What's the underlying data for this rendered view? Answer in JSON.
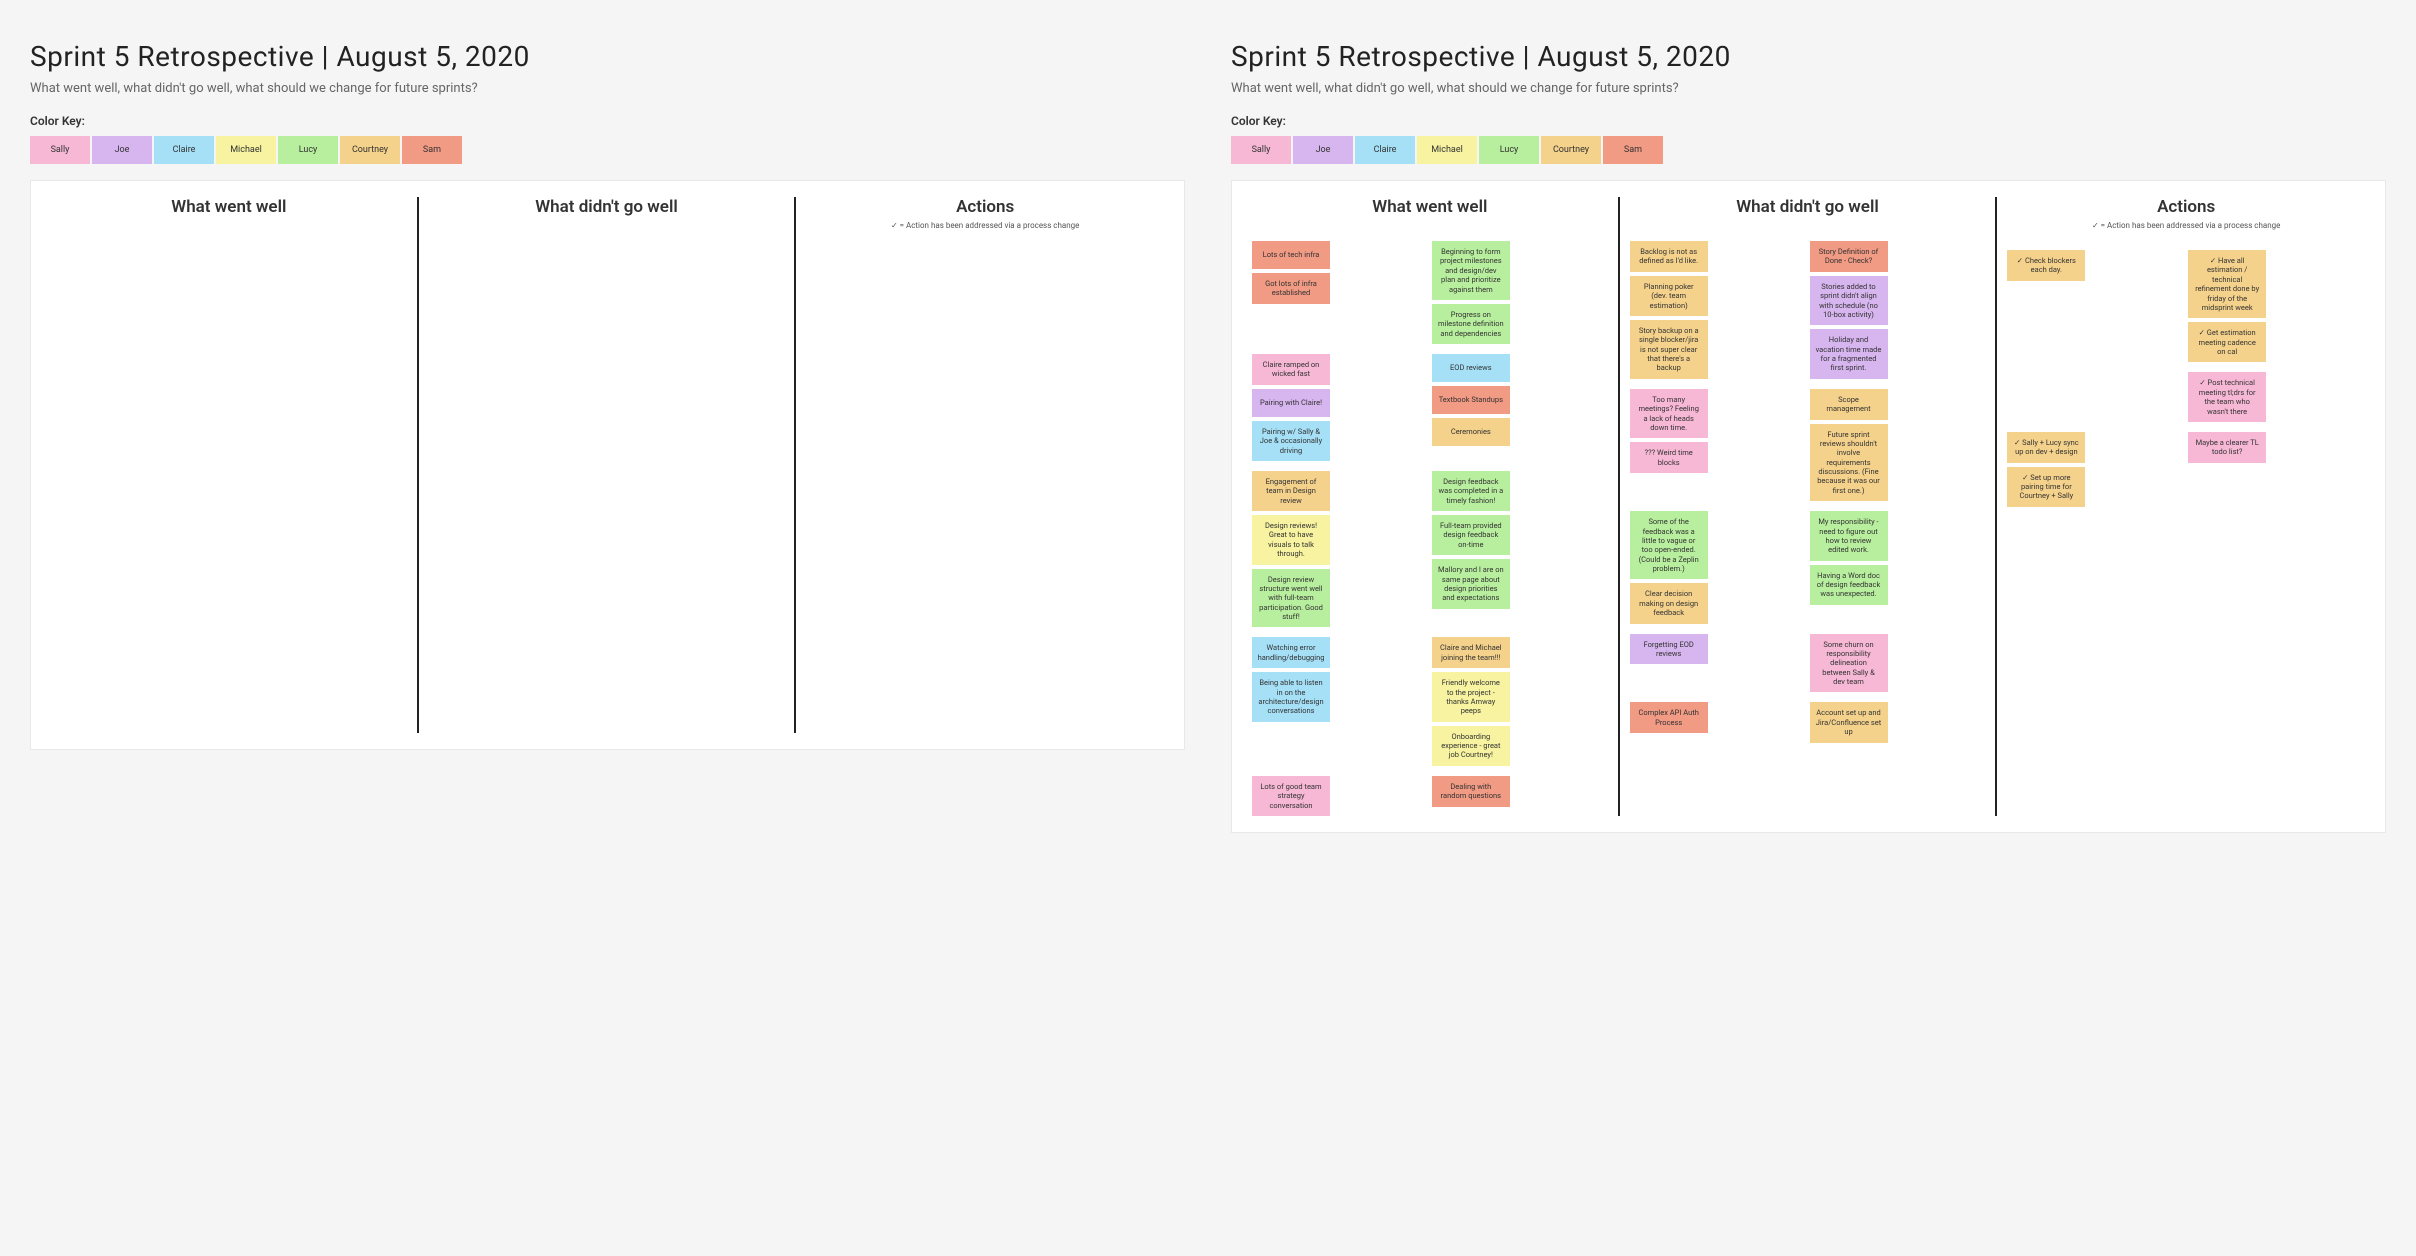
{
  "header": {
    "title": "Sprint 5 Retrospective  |  August 5, 2020",
    "subtitle": "What went well, what didn't go well, what should we change for future sprints?",
    "color_key_label": "Color Key:"
  },
  "colors": {
    "sally": "#f7b8d6",
    "joe": "#d7b5ef",
    "claire": "#a5e0f7",
    "michael": "#f7f3a0",
    "lucy": "#b8ef9e",
    "courtney": "#f5d28b",
    "sam": "#f19a84"
  },
  "participants": [
    {
      "name": "Sally",
      "colorKey": "sally"
    },
    {
      "name": "Joe",
      "colorKey": "joe"
    },
    {
      "name": "Claire",
      "colorKey": "claire"
    },
    {
      "name": "Michael",
      "colorKey": "michael"
    },
    {
      "name": "Lucy",
      "colorKey": "lucy"
    },
    {
      "name": "Courtney",
      "colorKey": "courtney"
    },
    {
      "name": "Sam",
      "colorKey": "sam"
    }
  ],
  "columns": {
    "well": {
      "title": "What went well"
    },
    "bad": {
      "title": "What didn't go well"
    },
    "actions": {
      "title": "Actions",
      "subtitle": "✓ = Action has been addressed via a process change"
    }
  },
  "boards": {
    "left": {
      "filled": false
    },
    "right": {
      "filled": true,
      "well_clusters": [
        [
          [
            {
              "c": "sam",
              "t": "Lots of tech infra"
            },
            {
              "c": "sam",
              "t": "Got lots of infra established"
            }
          ],
          [
            {
              "c": "lucy",
              "t": "Beginning to form project milestones and design/dev plan and prioritize against them"
            },
            {
              "c": "lucy",
              "t": "Progress on milestone definition and dependencies"
            }
          ]
        ],
        [
          [
            {
              "c": "sally",
              "t": "Claire ramped on wicked fast"
            },
            {
              "c": "joe",
              "t": "Pairing with Claire!"
            },
            {
              "c": "claire",
              "t": "Pairing w/ Sally & Joe & occasionally driving"
            }
          ],
          [
            {
              "c": "claire",
              "t": "EOD reviews"
            },
            {
              "c": "sam",
              "t": "Textbook Standups"
            },
            {
              "c": "courtney",
              "t": "Ceremonies"
            }
          ]
        ],
        [
          [
            {
              "c": "courtney",
              "t": "Engagement of team in Design review"
            },
            {
              "c": "michael",
              "t": "Design reviews! Great to have visuals to talk through."
            },
            {
              "c": "lucy",
              "t": "Design review structure went well with full-team participation. Good stuff!"
            }
          ],
          [
            {
              "c": "lucy",
              "t": "Design feedback was completed in a timely fashion!"
            },
            {
              "c": "lucy",
              "t": "Full-team provided design feedback on-time"
            },
            {
              "c": "lucy",
              "t": "Mallory and I are on same page about design priorities and expectations"
            }
          ]
        ],
        [
          [
            {
              "c": "claire",
              "t": "Watching error handling/debugging"
            },
            {
              "c": "claire",
              "t": "Being able to listen in on the architecture/design conversations"
            }
          ],
          [
            {
              "c": "courtney",
              "t": "Claire and Michael joining the team!!!"
            },
            {
              "c": "michael",
              "t": "Friendly welcome to the project - thanks Amway peeps"
            },
            {
              "c": "michael",
              "t": "Onboarding experience - great job Courtney!"
            }
          ]
        ],
        [
          [
            {
              "c": "sally",
              "t": "Lots of good team strategy conversation"
            }
          ],
          [
            {
              "c": "sam",
              "t": "Dealing with random questions"
            }
          ]
        ]
      ],
      "bad_clusters": [
        [
          [
            {
              "c": "courtney",
              "t": "Backlog is not as defined as I'd like."
            },
            {
              "c": "courtney",
              "t": "Planning poker (dev. team estimation)"
            },
            {
              "c": "courtney",
              "t": "Story backup on a single blocker/jira is not super clear that there's a backup"
            }
          ],
          [
            {
              "c": "sam",
              "t": "Story Definition of Done - Check?"
            },
            {
              "c": "joe",
              "t": "Stories added to sprint didn't align with schedule (no 10-box activity)"
            },
            {
              "c": "joe",
              "t": "Holiday and vacation time made for a fragmented first sprint."
            }
          ]
        ],
        [
          [
            {
              "c": "sally",
              "t": "Too many meetings? Feeling a lack of heads down time."
            },
            {
              "c": "sally",
              "t": "??? Weird time blocks"
            }
          ],
          [
            {
              "c": "courtney",
              "t": "Scope management"
            },
            {
              "c": "courtney",
              "t": "Future sprint reviews shouldn't involve requirements discussions. (Fine because it was our first one.)"
            }
          ]
        ],
        [
          [
            {
              "c": "lucy",
              "t": "Some of the feedback was a little to vague or too open-ended. (Could be a Zeplin problem.)"
            },
            {
              "c": "courtney",
              "t": "Clear decision making on design feedback"
            }
          ],
          [
            {
              "c": "lucy",
              "t": "My responsibility - need to figure out how to review edited work."
            },
            {
              "c": "lucy",
              "t": "Having a Word doc of design feedback was unexpected."
            }
          ]
        ],
        [
          [
            {
              "c": "joe",
              "t": "Forgetting EOD reviews"
            }
          ],
          [
            {
              "c": "sally",
              "t": "Some churn on responsibility delineation between Sally & dev team"
            }
          ]
        ],
        [
          [
            {
              "c": "sam",
              "t": "Complex API Auth Process"
            }
          ],
          [
            {
              "c": "courtney",
              "t": "Account set up and Jira/Confluence set up"
            }
          ]
        ]
      ],
      "actions_clusters": [
        [
          [
            {
              "c": "courtney",
              "t": "✓ Check blockers each day."
            }
          ],
          [
            {
              "c": "courtney",
              "t": "✓ Have all estimation / technical refinement done by friday of the midsprint week"
            },
            {
              "c": "courtney",
              "t": "✓ Get estimation meeting cadence on cal"
            }
          ]
        ],
        [
          [],
          [
            {
              "c": "sally",
              "t": "✓ Post technical meeting tl;drs for the team who wasn't there"
            }
          ]
        ],
        [
          [
            {
              "c": "courtney",
              "t": "✓ Sally + Lucy sync up on dev + design"
            },
            {
              "c": "courtney",
              "t": "✓ Set up more pairing time for Courtney + Sally"
            }
          ],
          [
            {
              "c": "sally",
              "t": "Maybe a clearer TL todo list?"
            }
          ]
        ]
      ]
    }
  }
}
